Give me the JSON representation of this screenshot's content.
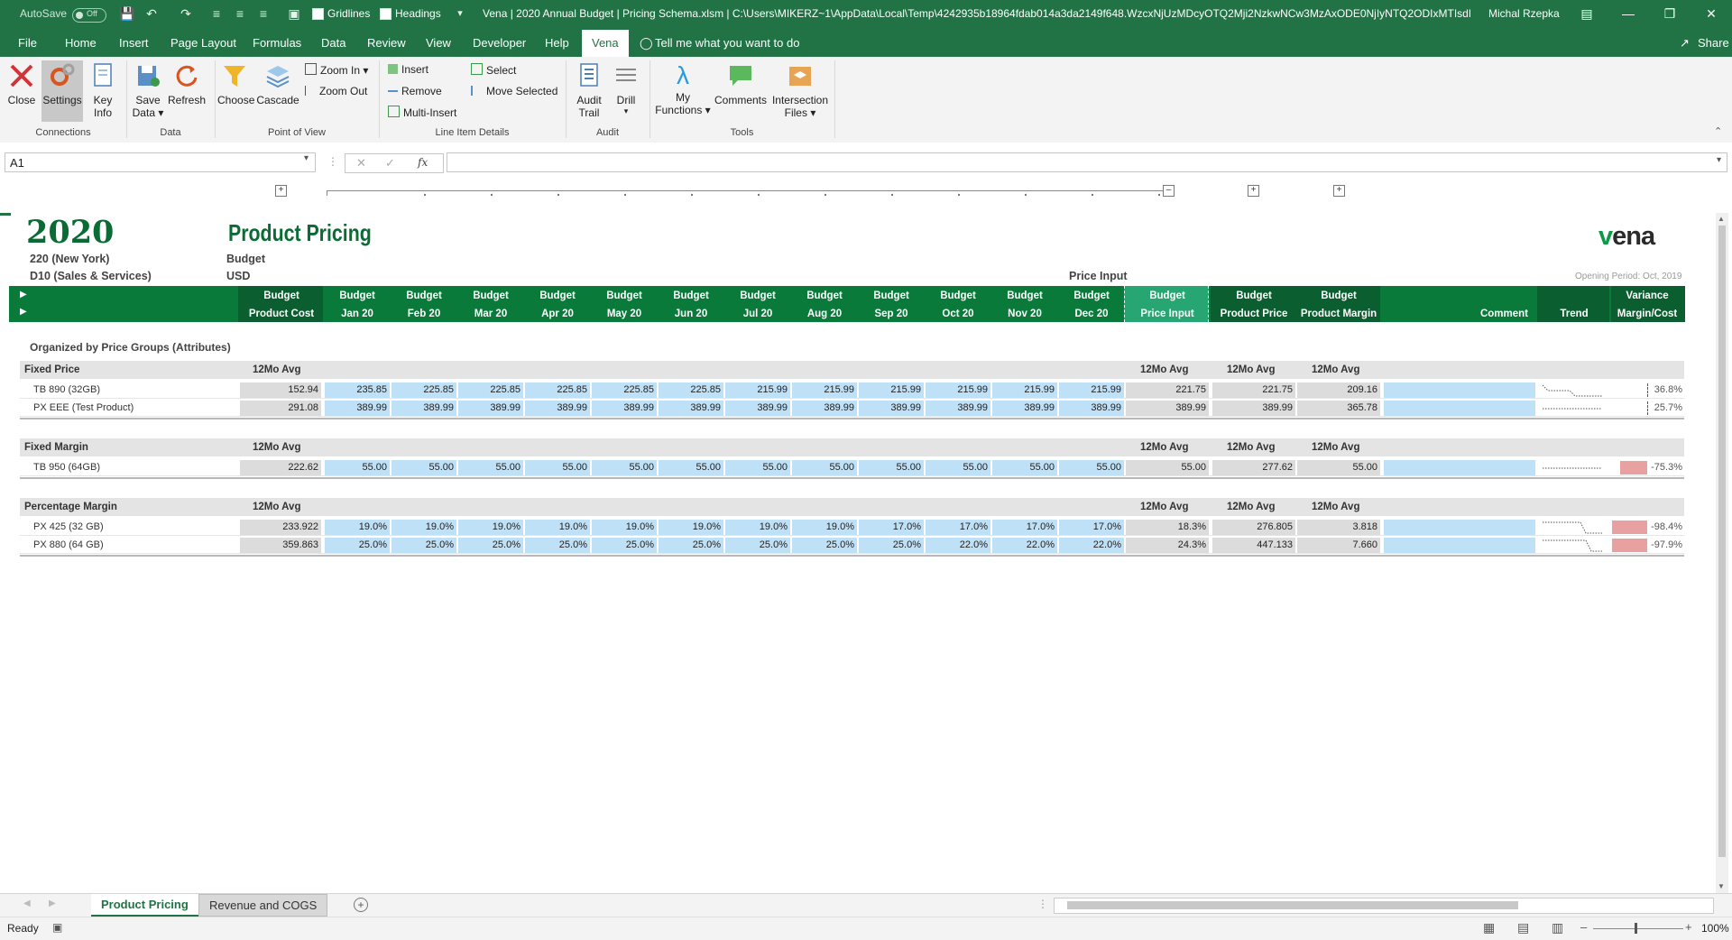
{
  "titlebar": {
    "autosave": "AutoSave",
    "autosave_state": "Off",
    "gridlines": "Gridlines",
    "headings": "Headings",
    "title": "Vena | 2020 Annual Budget | Pricing Schema.xlsm | C:\\Users\\MIKERZ~1\\AppData\\Local\\Temp\\4242935b18964fdab014a3da2149f648.WzcxNjUzMDcyOTQ2Mji2NzkwNCw3MzAxODE0NjIyNTQ2ODIxMTIsdHJ1ZS...",
    "user": "Michal Rzepka"
  },
  "ribbon_tabs": [
    "File",
    "Home",
    "Insert",
    "Page Layout",
    "Formulas",
    "Data",
    "Review",
    "View",
    "Developer",
    "Help",
    "Vena"
  ],
  "tell_me": "Tell me what you want to do",
  "share": "Share",
  "ribbon": {
    "close": "Close",
    "settings": "Settings",
    "key_info_1": "Key",
    "key_info_2": "Info",
    "save_data_1": "Save",
    "save_data_2": "Data",
    "refresh": "Refresh",
    "choose": "Choose",
    "cascade": "Cascade",
    "zoom_in": "Zoom In",
    "zoom_out": "Zoom Out",
    "insert": "Insert",
    "remove": "Remove",
    "multi_insert": "Multi-Insert",
    "select": "Select",
    "move_selected": "Move Selected",
    "audit_trail_1": "Audit",
    "audit_trail_2": "Trail",
    "drill": "Drill",
    "my_functions_1": "My",
    "my_functions_2": "Functions",
    "comments": "Comments",
    "intersection_1": "Intersection",
    "intersection_2": "Files",
    "groups": {
      "connections": "Connections",
      "data": "Data",
      "pov": "Point of View",
      "lid": "Line Item Details",
      "audit": "Audit",
      "tools": "Tools"
    }
  },
  "formula_bar": {
    "name_box": "A1",
    "fx": "fx",
    "formula": ""
  },
  "sheet": {
    "year": "2020",
    "title": "Product Pricing",
    "entity": "220 (New York)",
    "department": "D10 (Sales & Services)",
    "scenario": "Budget",
    "currency": "USD",
    "price_input_label": "Price Input",
    "opening_period": "Opening Period: Oct, 2019",
    "logo": "vena",
    "header_top": [
      "Budget",
      "Budget",
      "Budget",
      "Budget",
      "Budget",
      "Budget",
      "Budget",
      "Budget",
      "Budget",
      "Budget",
      "Budget",
      "Budget",
      "Budget",
      "Budget",
      "Budget",
      "Budget"
    ],
    "header_bottom": [
      "Product Cost",
      "Jan 20",
      "Feb 20",
      "Mar 20",
      "Apr 20",
      "May 20",
      "Jun 20",
      "Jul 20",
      "Aug 20",
      "Sep 20",
      "Oct 20",
      "Nov 20",
      "Dec 20",
      "Price Input",
      "Product Price",
      "Product Margin"
    ],
    "col_comment": "Comment",
    "col_trend": "Trend",
    "col_variance_1": "Variance",
    "col_variance_2": "Margin/Cost",
    "organized_by": "Organized by Price Groups (Attributes)",
    "avg_label": "12Mo Avg",
    "sections": [
      {
        "name": "Fixed Price",
        "rows": [
          {
            "label": "TB 890 (32GB)",
            "cost": "152.94",
            "months": [
              "235.85",
              "225.85",
              "225.85",
              "225.85",
              "225.85",
              "225.85",
              "215.99",
              "215.99",
              "215.99",
              "215.99",
              "215.99",
              "215.99"
            ],
            "price_input": "221.75",
            "price": "221.75",
            "margin": "209.16",
            "variance": "36.8%",
            "neg": false
          },
          {
            "label": "PX EEE (Test Product)",
            "cost": "291.08",
            "months": [
              "389.99",
              "389.99",
              "389.99",
              "389.99",
              "389.99",
              "389.99",
              "389.99",
              "389.99",
              "389.99",
              "389.99",
              "389.99",
              "389.99"
            ],
            "price_input": "389.99",
            "price": "389.99",
            "margin": "365.78",
            "variance": "25.7%",
            "neg": false
          }
        ]
      },
      {
        "name": "Fixed Margin",
        "rows": [
          {
            "label": "TB 950 (64GB)",
            "cost": "222.62",
            "months": [
              "55.00",
              "55.00",
              "55.00",
              "55.00",
              "55.00",
              "55.00",
              "55.00",
              "55.00",
              "55.00",
              "55.00",
              "55.00",
              "55.00"
            ],
            "price_input": "55.00",
            "price": "277.62",
            "margin": "55.00",
            "variance": "-75.3%",
            "neg": true
          }
        ]
      },
      {
        "name": "Percentage Margin",
        "rows": [
          {
            "label": "PX 425 (32 GB)",
            "cost": "233.922",
            "months": [
              "19.0%",
              "19.0%",
              "19.0%",
              "19.0%",
              "19.0%",
              "19.0%",
              "19.0%",
              "19.0%",
              "17.0%",
              "17.0%",
              "17.0%",
              "17.0%"
            ],
            "price_input": "18.3%",
            "price": "276.805",
            "margin": "3.818",
            "variance": "-98.4%",
            "neg": true
          },
          {
            "label": "PX 880 (64 GB)",
            "cost": "359.863",
            "months": [
              "25.0%",
              "25.0%",
              "25.0%",
              "25.0%",
              "25.0%",
              "25.0%",
              "25.0%",
              "25.0%",
              "25.0%",
              "22.0%",
              "22.0%",
              "22.0%"
            ],
            "price_input": "24.3%",
            "price": "447.133",
            "margin": "7.660",
            "variance": "-97.9%",
            "neg": true
          }
        ]
      }
    ]
  },
  "sheet_tabs": [
    "Product Pricing",
    "Revenue and COGS"
  ],
  "status": {
    "ready": "Ready",
    "zoom": "100%"
  },
  "colors": {
    "excel_green": "#217346",
    "vena_green": "#0a7a3b",
    "input_blue": "#bfe1f7",
    "neg_red": "#e8a0a0"
  }
}
